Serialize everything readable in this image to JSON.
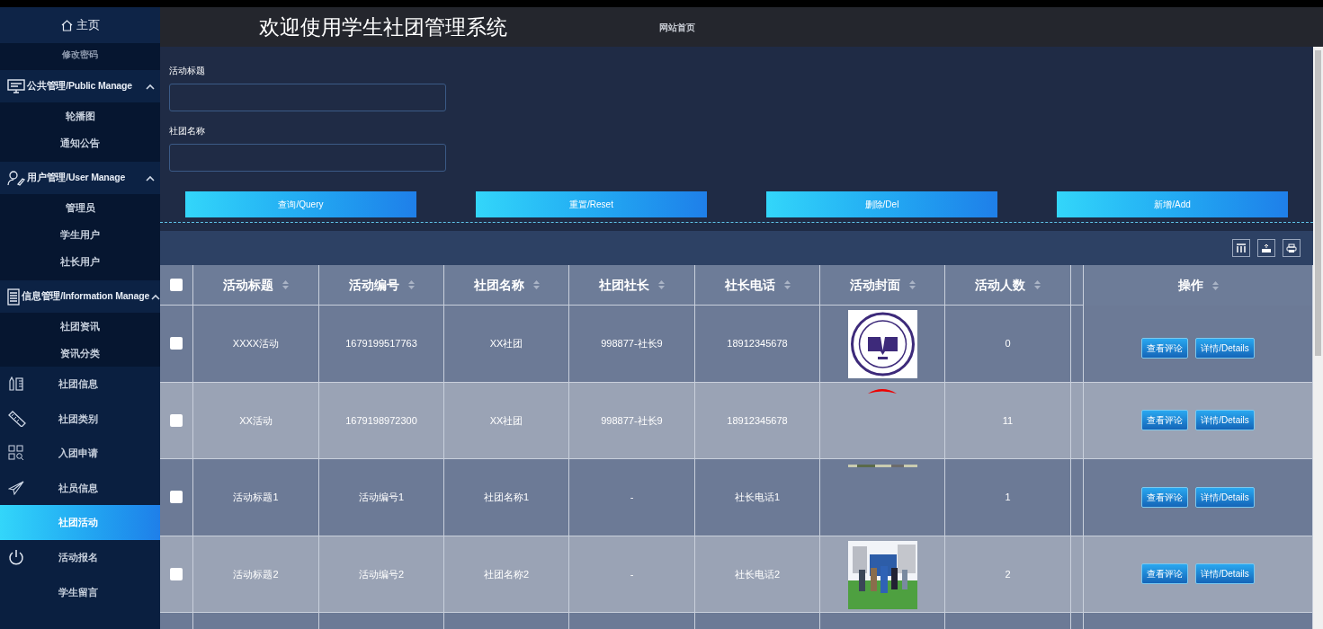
{
  "header": {
    "title": "欢迎使用学生社团管理系统",
    "nav_link": "网站首页"
  },
  "sidebar": {
    "home": "主页",
    "items": [
      {
        "kind": "sub",
        "label": "修改密码"
      },
      {
        "kind": "group",
        "label": "公共管理/Public Manage",
        "expanded": true,
        "children": [
          "轮播图",
          "通知公告"
        ]
      },
      {
        "kind": "group",
        "label": "用户管理/User Manage",
        "expanded": true,
        "children": [
          "管理员",
          "学生用户",
          "社长用户"
        ]
      },
      {
        "kind": "group",
        "label": "信息管理/Information Manage",
        "expanded": true,
        "children": [
          "社团资讯",
          "资讯分类"
        ]
      },
      {
        "kind": "item",
        "label": "社团信息",
        "selected": false
      },
      {
        "kind": "item",
        "label": "社团类别",
        "selected": false
      },
      {
        "kind": "item",
        "label": "入团申请",
        "selected": false
      },
      {
        "kind": "item",
        "label": "社员信息",
        "selected": false
      },
      {
        "kind": "item",
        "label": "社团活动",
        "selected": true
      },
      {
        "kind": "item",
        "label": "活动报名",
        "selected": false
      },
      {
        "kind": "item",
        "label": "学生留言",
        "selected": false
      }
    ]
  },
  "search": {
    "fields": [
      {
        "label": "活动标题"
      },
      {
        "label": "社团名称"
      }
    ],
    "buttons": [
      "查询/Query",
      "重置/Reset",
      "删除/Del",
      "新增/Add"
    ]
  },
  "table": {
    "select_all": false,
    "columns": [
      "活动标题",
      "活动编号",
      "社团名称",
      "社团社长",
      "社长电话",
      "活动封面",
      "活动人数",
      "操作"
    ],
    "rows": [
      {
        "checked": false,
        "cells": [
          "XXXX活动",
          "1679199517763",
          "XX社团",
          "998877-社长9",
          "18912345678",
          "0"
        ],
        "actions": [
          "查看评论",
          "详情/Details"
        ]
      },
      {
        "checked": false,
        "cells": [
          "XX活动",
          "1679198972300",
          "XX社团",
          "998877-社长9",
          "18912345678",
          "11"
        ],
        "actions": [
          "查看评论",
          "详情/Details"
        ]
      },
      {
        "checked": false,
        "cells": [
          "活动标题1",
          "活动编号1",
          "社团名称1",
          "-",
          "社长电话1",
          "1"
        ],
        "actions": [
          "查看评论",
          "详情/Details"
        ]
      },
      {
        "checked": false,
        "cells": [
          "活动标题2",
          "活动编号2",
          "社团名称2",
          "-",
          "社长电话2",
          "2"
        ],
        "actions": [
          "查看评论",
          "详情/Details"
        ]
      }
    ]
  }
}
